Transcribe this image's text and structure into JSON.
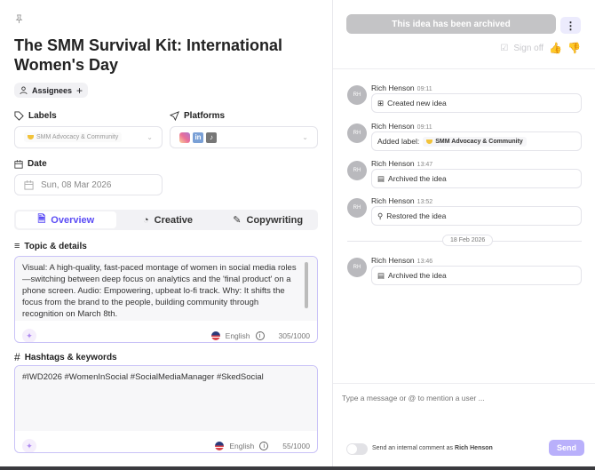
{
  "idea": {
    "title": "The SMM Survival Kit: International Women's Day",
    "assignees_label": "Assignees",
    "labels_heading": "Labels",
    "label_value": "SMM Advocacy & Community",
    "platforms_heading": "Platforms",
    "platforms": [
      {
        "name": "instagram-icon",
        "color": "#e1306c"
      },
      {
        "name": "linkedin-icon",
        "color": "#0a66c2"
      },
      {
        "name": "tiktok-icon",
        "color": "#111111"
      }
    ],
    "date_heading": "Date",
    "date_value": "Sun, 08 Mar 2026",
    "tabs": [
      {
        "label": "Overview",
        "active": true
      },
      {
        "label": "Creative",
        "active": false
      },
      {
        "label": "Copywriting",
        "active": false
      }
    ],
    "topic_heading": "Topic & details",
    "topic_text": "Visual: A high-quality, fast-paced montage of women in social media roles—switching between deep focus on analytics and the 'final product' on a phone screen. Audio: Empowering, upbeat lo-fi track. Why: It shifts the focus from the brand to the people, building community through recognition on March 8th.",
    "topic_language": "English",
    "topic_count": "305/1000",
    "hashtags_heading": "Hashtags & keywords",
    "hashtags_text": "#IWD2026 #WomenInSocial #SocialMediaManager #SkedSocial",
    "hashtags_language": "English",
    "hashtags_count": "55/1000"
  },
  "sidebar": {
    "archived_banner": "This idea has been archived",
    "sign_off": "Sign off",
    "events": [
      {
        "initials": "RH",
        "user": "Rich Henson",
        "time": "09:11",
        "text": "Created new idea",
        "icon": "plus-square-icon"
      },
      {
        "initials": "RH",
        "user": "Rich Henson",
        "time": "09:11",
        "text": "Added label:",
        "label": "SMM Advocacy & Community",
        "icon": ""
      },
      {
        "initials": "RH",
        "user": "Rich Henson",
        "time": "13:47",
        "text": "Archived the idea",
        "icon": "archive-icon"
      },
      {
        "initials": "RH",
        "user": "Rich Henson",
        "time": "13:52",
        "text": "Restored the idea",
        "icon": "lightbulb-icon"
      },
      {
        "initials": "RH",
        "user": "Rich Henson",
        "time": "13:46",
        "text": "Archived the idea",
        "icon": "archive-icon"
      }
    ],
    "date_divider": "18 Feb 2026",
    "message_placeholder": "Type a message or @ to mention a user ...",
    "internal_prefix": "Send an internal comment as",
    "internal_user": "Rich Henson",
    "send_label": "Send"
  },
  "colors": {
    "accent": "#5b4cf5",
    "send_button": "#b9b0fb",
    "archived_banner": "#c4c4c6"
  }
}
